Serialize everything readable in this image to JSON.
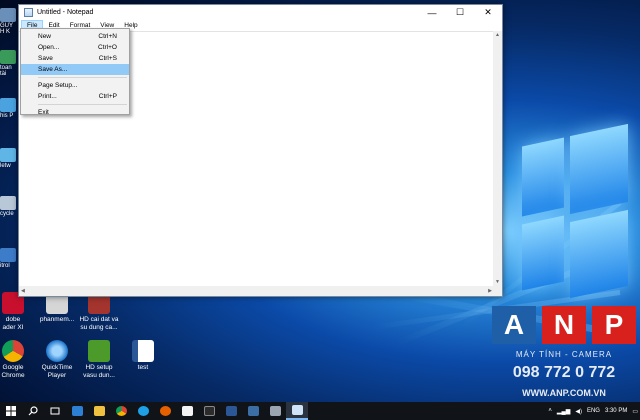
{
  "notepad": {
    "title": "Untitled - Notepad",
    "caption": {
      "minimize": "—",
      "maximize": "☐",
      "close": "✕"
    },
    "menu": [
      "File",
      "Edit",
      "Format",
      "View",
      "Help"
    ],
    "active_menu": "File"
  },
  "file_menu": {
    "items": [
      {
        "label": "New",
        "shortcut": "Ctrl+N"
      },
      {
        "label": "Open...",
        "shortcut": "Ctrl+O"
      },
      {
        "label": "Save",
        "shortcut": "Ctrl+S"
      },
      {
        "label": "Save As...",
        "shortcut": "",
        "highlighted": true
      },
      {
        "label": "Page Setup...",
        "shortcut": ""
      },
      {
        "label": "Print...",
        "shortcut": "Ctrl+P"
      },
      {
        "label": "Exit",
        "shortcut": ""
      }
    ]
  },
  "desktop": {
    "left_labels": [
      "GUY",
      "H K",
      "toan",
      "tài",
      "his P",
      "letw",
      "cycle",
      "itrol"
    ],
    "icons": [
      {
        "label": "dobe\nader XI",
        "color": "#c8102e"
      },
      {
        "label": "phanmem...",
        "color": "#d0d0d0"
      },
      {
        "label": "HD cai dat va\nsu dung ca...",
        "color": "#a4342e"
      },
      {
        "label": "Google\nChrome",
        "color": "#f2b705"
      },
      {
        "label": "QuickTime\nPlayer",
        "color": "#1b73c9"
      },
      {
        "label": "HD setup\nvasu dun...",
        "color": "#4c9a2a"
      },
      {
        "label": "test",
        "color": "#2b5797"
      }
    ]
  },
  "watermark": {
    "letters": [
      "A",
      "N",
      "P"
    ],
    "tagline": "MÁY TÍNH - CAMERA",
    "phone": "098 772 0 772",
    "site": "WWW.ANP.COM.VN"
  },
  "taskbar": {
    "lang": "ENG",
    "time": "3:30 PM"
  },
  "colors": {
    "menu_highlight": "#91c9f7",
    "anp_red": "#d8201c",
    "anp_blue": "#1e5fa8"
  }
}
